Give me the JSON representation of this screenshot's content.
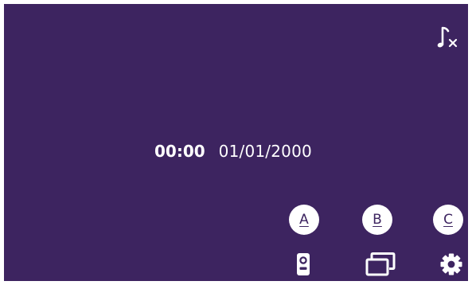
{
  "status": {
    "time": "00:00",
    "date": "01/01/2000"
  },
  "top_right": {
    "icon": "music-mute-icon"
  },
  "entrances": [
    {
      "label": "A"
    },
    {
      "label": "B"
    },
    {
      "label": "C"
    }
  ],
  "bottom_bar": {
    "icons": [
      "door-station-icon",
      "gallery-icon",
      "gear-icon"
    ]
  },
  "colors": {
    "background": "#3d2460",
    "foreground": "#ffffff"
  }
}
